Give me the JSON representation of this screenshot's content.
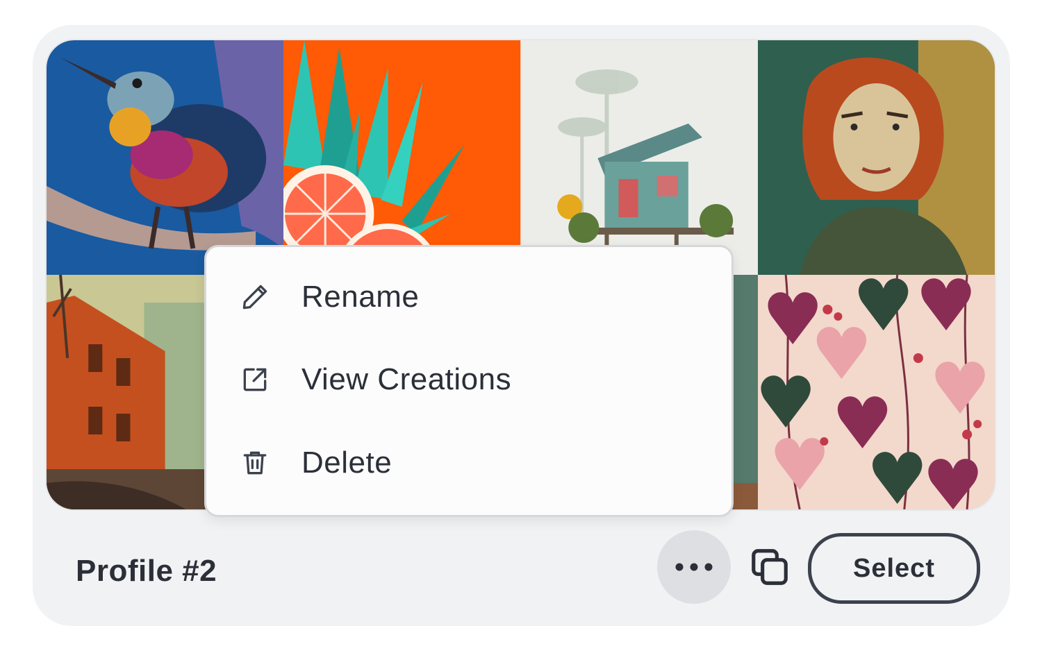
{
  "profile": {
    "title": "Profile #2"
  },
  "gallery": {
    "tiles": [
      {
        "name": "bird-artwork",
        "colors": [
          "#1a5aa0",
          "#6a63a8"
        ]
      },
      {
        "name": "citrus-agave-artwork",
        "colors": [
          "#ff5a05",
          "#2ec4b4"
        ]
      },
      {
        "name": "stilt-house-artwork",
        "colors": [
          "#ecede8",
          "#5f9c98"
        ]
      },
      {
        "name": "woman-portrait-artwork",
        "colors": [
          "#2f5f4f",
          "#c79a3e"
        ]
      },
      {
        "name": "orange-building-artwork",
        "colors": [
          "#c4501f",
          "#9fb48c"
        ]
      },
      {
        "name": "hidden-tile-6",
        "colors": [
          "#d8d6cf",
          "#b9b4a8"
        ]
      },
      {
        "name": "teal-tile-artwork",
        "colors": [
          "#3d7e7a",
          "#567a6b"
        ]
      },
      {
        "name": "floral-pattern-artwork",
        "colors": [
          "#f3d8cc",
          "#8a2d55"
        ]
      }
    ]
  },
  "context_menu": {
    "items": [
      {
        "label": "Rename",
        "icon": "pencil-icon"
      },
      {
        "label": "View Creations",
        "icon": "external-link-icon"
      },
      {
        "label": "Delete",
        "icon": "trash-icon"
      }
    ]
  },
  "actions": {
    "more_icon": "ellipsis-icon",
    "copy_icon": "duplicate-icon",
    "select_label": "Select"
  },
  "colors": {
    "card_bg": "#f1f2f4",
    "text": "#2b2f38",
    "more_btn_bg": "#dedfe2",
    "menu_border": "#d6d7da"
  }
}
